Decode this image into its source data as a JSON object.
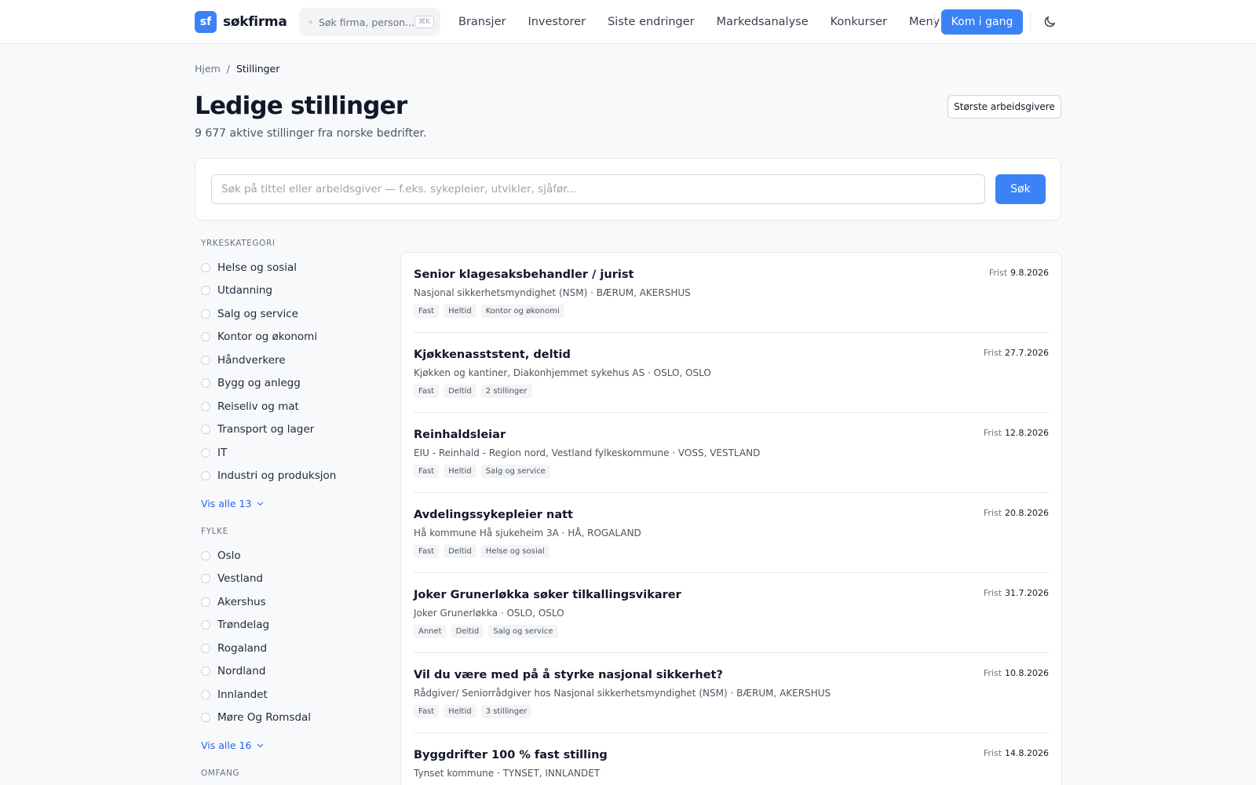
{
  "header": {
    "logo_mark": "sf",
    "logo_text": "søkfirma",
    "search_placeholder": "Søk firma, person...",
    "search_shortcut": "⌘K",
    "nav": [
      "Bransjer",
      "Investorer",
      "Siste endringer",
      "Markedsanalyse",
      "Konkurser"
    ],
    "menu_label": "Meny",
    "cta_label": "Kom i gang"
  },
  "breadcrumb": {
    "home": "Hjem",
    "separator": "/",
    "current": "Stillinger"
  },
  "page": {
    "title": "Ledige stillinger",
    "subtitle": "9 677 aktive stillinger fra norske bedrifter.",
    "top_employers_button": "Største arbeidsgivere"
  },
  "search": {
    "placeholder": "Søk på tittel eller arbeidsgiver — f.eks. sykepleier, utvikler, sjåfør...",
    "button": "Søk"
  },
  "filters": {
    "category": {
      "heading": "Yrkeskategori",
      "items": [
        "Helse og sosial",
        "Utdanning",
        "Salg og service",
        "Kontor og økonomi",
        "Håndverkere",
        "Bygg og anlegg",
        "Reiseliv og mat",
        "Transport og lager",
        "IT",
        "Industri og produksjon"
      ],
      "show_all": "Vis alle 13"
    },
    "county": {
      "heading": "Fylke",
      "items": [
        "Oslo",
        "Vestland",
        "Akershus",
        "Trøndelag",
        "Rogaland",
        "Nordland",
        "Innlandet",
        "Møre Og Romsdal"
      ],
      "show_all": "Vis alle 16"
    },
    "scope": {
      "heading": "Omfang"
    }
  },
  "jobs": {
    "deadline_label": "Frist",
    "items": [
      {
        "title": "Senior klagesaksbehandler / jurist",
        "meta": "Nasjonal sikkerhetsmyndighet (NSM) · BÆRUM, AKERSHUS",
        "tags": [
          "Fast",
          "Heltid",
          "Kontor og økonomi"
        ],
        "deadline": "9.8.2026"
      },
      {
        "title": "Kjøkkenasststent, deltid",
        "meta": "Kjøkken og kantiner, Diakonhjemmet sykehus AS · OSLO, OSLO",
        "tags": [
          "Fast",
          "Deltid",
          "2 stillinger"
        ],
        "deadline": "27.7.2026"
      },
      {
        "title": "Reinhaldsleiar",
        "meta": "EIU - Reinhald - Region nord, Vestland fylkeskommune · VOSS, VESTLAND",
        "tags": [
          "Fast",
          "Heltid",
          "Salg og service"
        ],
        "deadline": "12.8.2026"
      },
      {
        "title": "Avdelingssykepleier natt",
        "meta": "Hå kommune Hå sjukeheim 3A · HÅ, ROGALAND",
        "tags": [
          "Fast",
          "Deltid",
          "Helse og sosial"
        ],
        "deadline": "20.8.2026"
      },
      {
        "title": "Joker Grunerløkka søker tilkallingsvikarer",
        "meta": "Joker Grunerløkka · OSLO, OSLO",
        "tags": [
          "Annet",
          "Deltid",
          "Salg og service"
        ],
        "deadline": "31.7.2026"
      },
      {
        "title": "Vil du være med på å styrke nasjonal sikkerhet?",
        "meta": "Rådgiver/ Seniorrådgiver hos Nasjonal sikkerhetsmyndighet (NSM) · BÆRUM, AKERSHUS",
        "tags": [
          "Fast",
          "Heltid",
          "3 stillinger"
        ],
        "deadline": "10.8.2026"
      },
      {
        "title": "Byggdrifter 100 % fast stilling",
        "meta": "Tynset kommune · TYNSET, INNLANDET",
        "tags": [],
        "deadline": "14.8.2026"
      }
    ]
  }
}
